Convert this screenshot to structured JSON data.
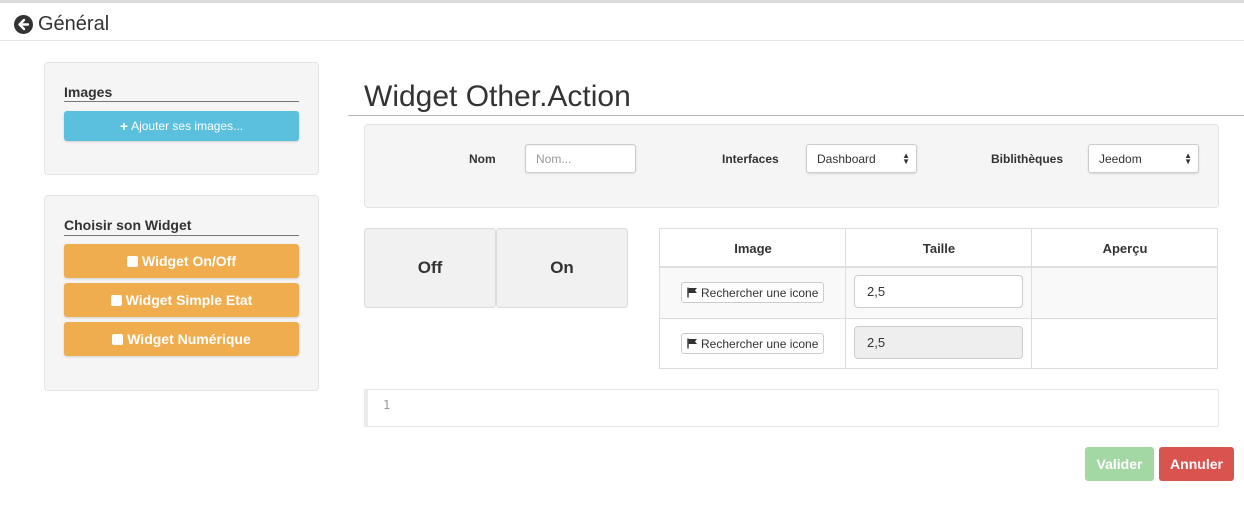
{
  "header": {
    "back_label": "Général"
  },
  "sidebar": {
    "images_title": "Images",
    "add_images_label": "Ajouter ses images...",
    "choose_widget_title": "Choisir son Widget",
    "widget_buttons": [
      "Widget On/Off",
      "Widget Simple Etat",
      "Widget Numérique"
    ]
  },
  "main": {
    "title": "Widget Other.Action",
    "form": {
      "name_label": "Nom",
      "name_placeholder": "Nom...",
      "interfaces_label": "Interfaces",
      "interfaces_value": "Dashboard",
      "libraries_label": "Biblithèques",
      "libraries_value": "Jeedom"
    },
    "state_tabs": [
      "Off",
      "On"
    ],
    "table": {
      "headers": [
        "Image",
        "Taille",
        "Aperçu"
      ],
      "rows": [
        {
          "button": "Rechercher une icone",
          "size": "2,5"
        },
        {
          "button": "Rechercher une icone",
          "size": "2,5"
        }
      ]
    },
    "code_editor": {
      "line_number": "1"
    },
    "actions": {
      "validate_label": "Valider",
      "cancel_label": "Annuler"
    }
  },
  "colors": {
    "info": "#5bc0de",
    "warning": "#f0ad4e",
    "success_disabled": "#a3d7a3",
    "danger": "#d9534f"
  },
  "icons": [
    "arrow-circle-left-icon",
    "plus-icon",
    "square-icon",
    "flag-icon",
    "sort-caret-icon"
  ]
}
